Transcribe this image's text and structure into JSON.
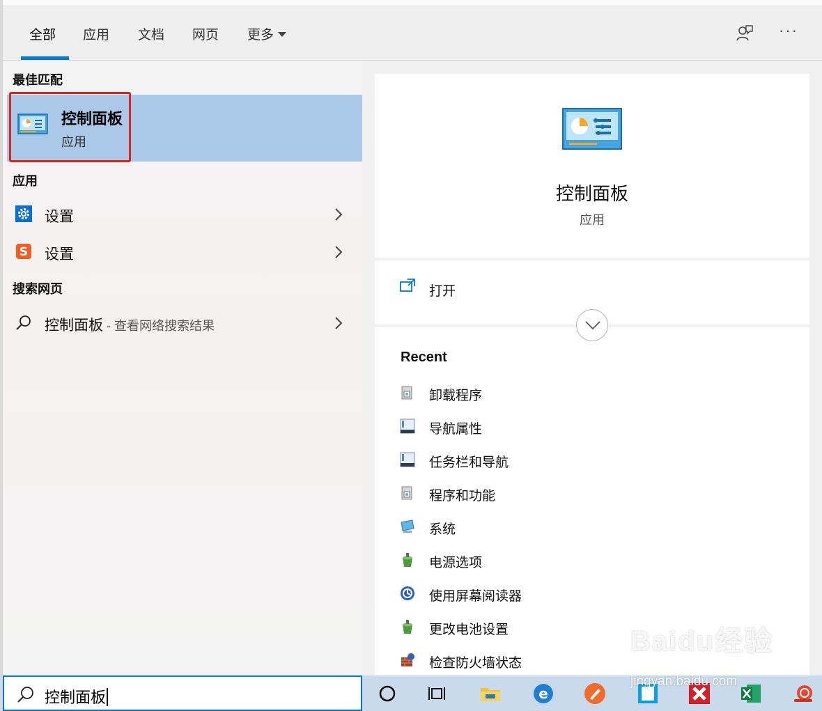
{
  "tabs": [
    {
      "label": "全部"
    },
    {
      "label": "应用"
    },
    {
      "label": "文档"
    },
    {
      "label": "网页"
    },
    {
      "label": "更多"
    }
  ],
  "colors": {
    "accent": "#0078d7",
    "selection": "#aac9e8",
    "highlight_box": "#e0241b"
  },
  "sections": {
    "best_match": "最佳匹配",
    "apps": "应用",
    "web": "搜索网页"
  },
  "best_match": {
    "title": "控制面板",
    "subtitle": "应用",
    "icon": "control-panel-icon"
  },
  "apps": [
    {
      "label": "设置",
      "icon": "settings-gear-icon"
    },
    {
      "label": "设置",
      "icon": "sogou-s-icon"
    }
  ],
  "web": {
    "query": "控制面板",
    "suffix": " - 查看网络搜索结果"
  },
  "preview": {
    "title": "控制面板",
    "subtitle": "应用",
    "open_label": "打开"
  },
  "recent": {
    "title": "Recent",
    "items": [
      {
        "label": "卸载程序"
      },
      {
        "label": "导航属性"
      },
      {
        "label": "任务栏和导航"
      },
      {
        "label": "程序和功能"
      },
      {
        "label": "系统"
      },
      {
        "label": "电源选项"
      },
      {
        "label": "使用屏幕阅读器"
      },
      {
        "label": "更改电池设置"
      },
      {
        "label": "检查防火墙状态"
      }
    ]
  },
  "search": {
    "value": "控制面板"
  },
  "watermark": {
    "logo": "Baidu经验",
    "url": "jingyan.baidu.com"
  }
}
